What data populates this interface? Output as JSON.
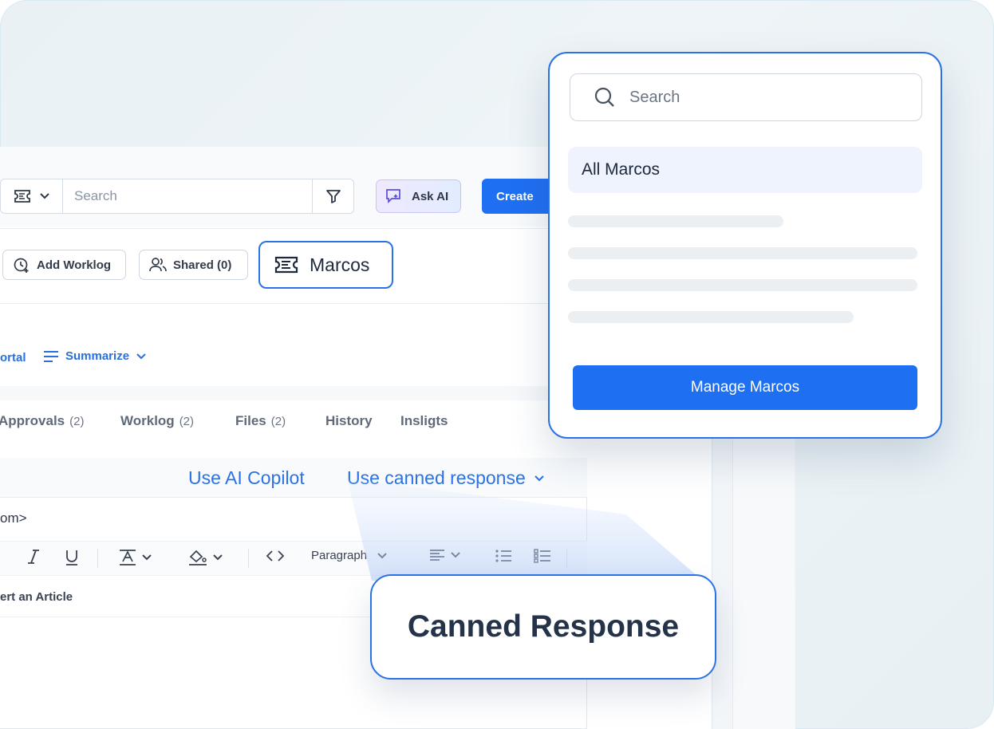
{
  "toolbar": {
    "search_placeholder": "Search",
    "ask_ai_label": "Ask AI",
    "create_label": "Create"
  },
  "actions": {
    "add_worklog_label": "Add Worklog",
    "shared_label": "Shared (0)",
    "marcos_label": "Marcos"
  },
  "links": {
    "portal_label": "ortal",
    "summarize_label": "Summarize"
  },
  "tabs": [
    {
      "label": "Approvals",
      "count": "(2)"
    },
    {
      "label": "Worklog",
      "count": "(2)"
    },
    {
      "label": "Files",
      "count": "(2)"
    },
    {
      "label": "History",
      "count": ""
    },
    {
      "label": "Insligts",
      "count": ""
    }
  ],
  "editor": {
    "copilot_label": "Use AI Copilot",
    "canned_label": "Use canned response",
    "to_text": "om>",
    "paragraph_label": "Paragraph",
    "insert_article_label": "ert an Article"
  },
  "dropdown": {
    "search_placeholder": "Search",
    "all_marcos_label": "All Marcos",
    "manage_label": "Manage Marcos"
  },
  "callout": {
    "canned_response_label": "Canned Response"
  },
  "colors": {
    "accent": "#1f6ff2",
    "outline": "#2a72e6",
    "link": "#2a6fdb"
  }
}
